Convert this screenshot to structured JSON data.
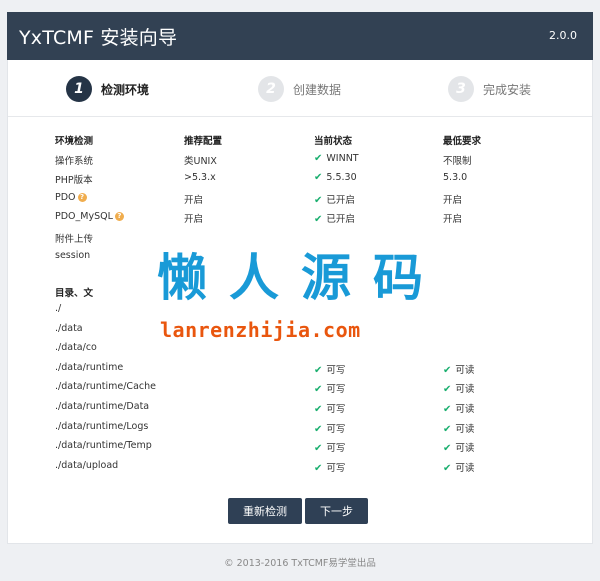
{
  "header": {
    "title": "YxTCMF 安装向导",
    "version": "2.0.0"
  },
  "steps": [
    {
      "num": "1",
      "label": "检测环境"
    },
    {
      "num": "2",
      "label": "创建数据"
    },
    {
      "num": "3",
      "label": "完成安装"
    }
  ],
  "env": {
    "headers": [
      "环境检测",
      "推荐配置",
      "当前状态",
      "最低要求"
    ],
    "rows": [
      {
        "name": "操作系统",
        "recommended": "类UNIX",
        "status": "WINNT",
        "minimum": "不限制"
      },
      {
        "name": "PHP版本",
        "recommended": ">5.3.x",
        "status": "5.5.30",
        "minimum": "5.3.0"
      },
      {
        "name": "PDO",
        "recommended": "开启",
        "status": "已开启",
        "minimum": "开启"
      },
      {
        "name": "PDO_MySQL",
        "recommended": "开启",
        "status": "已开启",
        "minimum": "开启"
      },
      {
        "name": "附件上传",
        "recommended": "",
        "status": "",
        "minimum": ""
      },
      {
        "name": "session",
        "recommended": "",
        "status": "",
        "minimum": ""
      }
    ]
  },
  "dirs": {
    "header": "目录、文",
    "rows": [
      {
        "path": "./",
        "write": "",
        "read": ""
      },
      {
        "path": "./data",
        "write": "",
        "read": ""
      },
      {
        "path": "./data/co",
        "write": "",
        "read": ""
      },
      {
        "path": "./data/runtime",
        "write": "可写",
        "read": "可读"
      },
      {
        "path": "./data/runtime/Cache",
        "write": "可写",
        "read": "可读"
      },
      {
        "path": "./data/runtime/Data",
        "write": "可写",
        "read": "可读"
      },
      {
        "path": "./data/runtime/Logs",
        "write": "可写",
        "read": "可读"
      },
      {
        "path": "./data/runtime/Temp",
        "write": "可写",
        "read": "可读"
      },
      {
        "path": "./data/upload",
        "write": "可写",
        "read": "可读"
      }
    ]
  },
  "buttons": {
    "recheck": "重新检测",
    "next": "下一步"
  },
  "footer": "© 2013-2016 TxTCMF易学堂出品",
  "watermark": {
    "main": "懒人源码",
    "sub": "lanrenzhijia.com"
  },
  "colors": {
    "header_bg": "#324153",
    "button_bg": "#2f4055",
    "ok_green": "#1aaf6f",
    "warn_orange": "#f0ad4e"
  }
}
